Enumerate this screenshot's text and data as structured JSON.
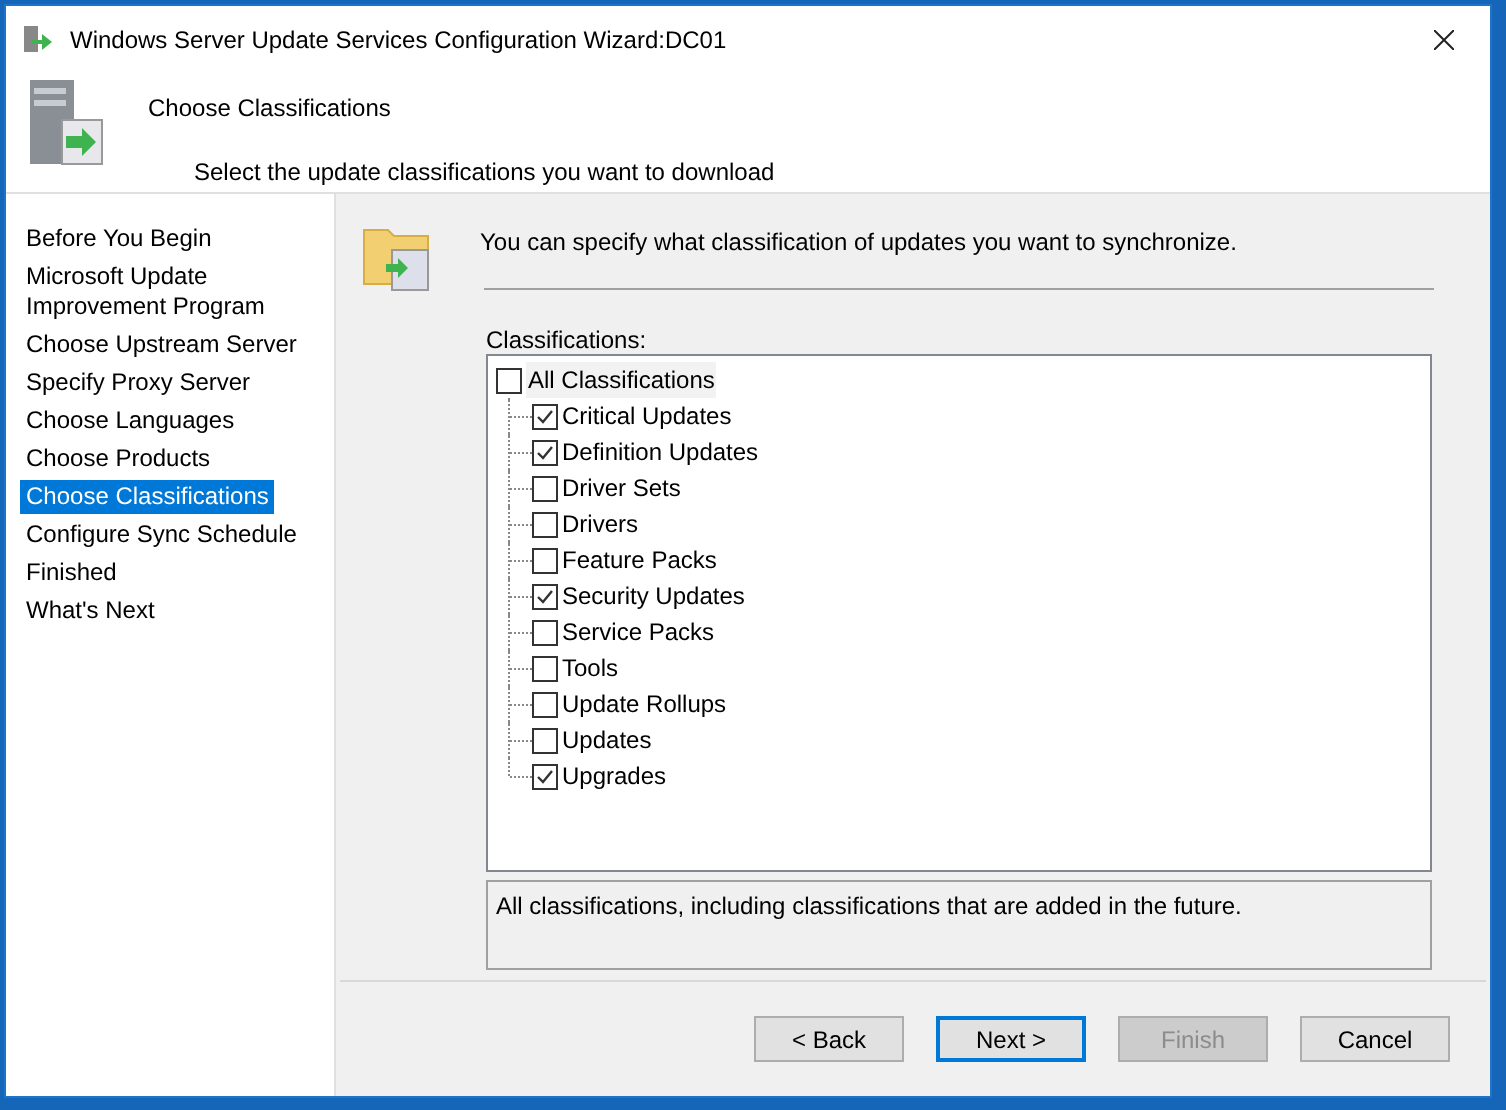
{
  "window": {
    "title": "Windows Server Update Services Configuration Wizard:DC01"
  },
  "header": {
    "title": "Choose Classifications",
    "subtitle": "Select the update classifications you want to download"
  },
  "sidebar": {
    "items": [
      {
        "label": "Before You Begin",
        "selected": false
      },
      {
        "label": "Microsoft Update Improvement Program",
        "selected": false
      },
      {
        "label": "Choose Upstream Server",
        "selected": false
      },
      {
        "label": "Specify Proxy Server",
        "selected": false
      },
      {
        "label": "Choose Languages",
        "selected": false
      },
      {
        "label": "Choose Products",
        "selected": false
      },
      {
        "label": "Choose Classifications",
        "selected": true
      },
      {
        "label": "Configure Sync Schedule",
        "selected": false
      },
      {
        "label": "Finished",
        "selected": false
      },
      {
        "label": "What's Next",
        "selected": false
      }
    ]
  },
  "intro": "You can specify what classification of updates you want to synchronize.",
  "classifications_label": "Classifications:",
  "tree": {
    "label": "All Classifications",
    "checked": false,
    "selected": true,
    "children": [
      {
        "label": "Critical Updates",
        "checked": true
      },
      {
        "label": "Definition Updates",
        "checked": true
      },
      {
        "label": "Driver Sets",
        "checked": false
      },
      {
        "label": "Drivers",
        "checked": false
      },
      {
        "label": "Feature Packs",
        "checked": false
      },
      {
        "label": "Security Updates",
        "checked": true
      },
      {
        "label": "Service Packs",
        "checked": false
      },
      {
        "label": "Tools",
        "checked": false
      },
      {
        "label": "Update Rollups",
        "checked": false
      },
      {
        "label": "Updates",
        "checked": false
      },
      {
        "label": "Upgrades",
        "checked": true
      }
    ]
  },
  "description": "All classifications, including classifications that are added in the future.",
  "buttons": [
    {
      "label": "< Back",
      "disabled": false,
      "focused": false
    },
    {
      "label": "Next >",
      "disabled": false,
      "focused": true
    },
    {
      "label": "Finish",
      "disabled": true,
      "focused": false
    },
    {
      "label": "Cancel",
      "disabled": false,
      "focused": false
    }
  ]
}
